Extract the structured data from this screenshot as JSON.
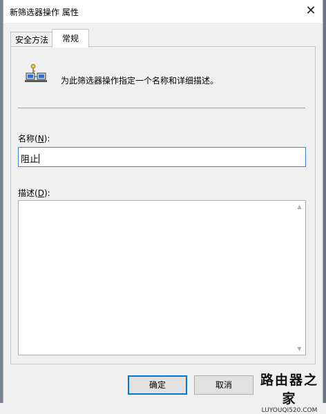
{
  "window": {
    "title": "新筛选器操作 属性",
    "close_glyph": "✕"
  },
  "tabs": [
    {
      "label": "安全方法",
      "active": false
    },
    {
      "label": "常规",
      "active": true
    }
  ],
  "general": {
    "description_text": "为此筛选器操作指定一个名称和详细描述。",
    "name_label_prefix": "名称(",
    "name_label_mnemonic": "N",
    "name_label_suffix": "):",
    "name_value": "阻止",
    "desc_label_prefix": "描述(",
    "desc_label_mnemonic": "D",
    "desc_label_suffix": "):",
    "desc_value": ""
  },
  "buttons": {
    "ok_label": "确定",
    "cancel_label": "取消"
  },
  "watermark": {
    "main": "路由器之家",
    "sub": "LUYOUQI520.COM"
  },
  "icons": {
    "filter_action": "network-computers-key-icon",
    "scroll_up": "chevron-up-icon",
    "scroll_down": "chevron-down-icon"
  },
  "colors": {
    "focus_border": "#0078d7",
    "background": "#f0f0f0"
  }
}
